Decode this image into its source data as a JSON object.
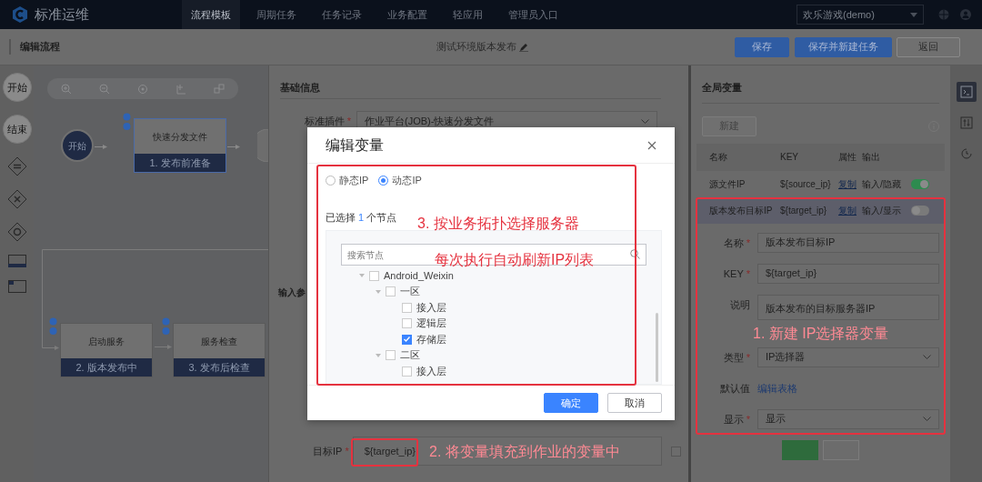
{
  "required_mark": "*",
  "header": {
    "title": "标准运维",
    "nav": [
      {
        "label": "流程模板",
        "selected": true
      },
      {
        "label": "周期任务",
        "selected": false
      },
      {
        "label": "任务记录",
        "selected": false
      },
      {
        "label": "业务配置",
        "selected": false
      },
      {
        "label": "轻应用",
        "selected": false
      },
      {
        "label": "管理员入口",
        "selected": false
      }
    ],
    "business": "欢乐游戏(demo)"
  },
  "toolbar": {
    "title": "编辑流程",
    "flow_name": "测试环境版本发布",
    "buttons": [
      {
        "label": "保存",
        "kind": "primary"
      },
      {
        "label": "保存并新建任务",
        "kind": "primary"
      },
      {
        "label": "返回",
        "kind": "default"
      }
    ]
  },
  "palette": [
    {
      "kind": "circle",
      "label": "开始"
    },
    {
      "kind": "circle",
      "label": "结束"
    },
    {
      "kind": "diamond-equal"
    },
    {
      "kind": "diamond-cross"
    },
    {
      "kind": "diamond-circle"
    },
    {
      "kind": "rect-bar"
    },
    {
      "kind": "rect-corner"
    }
  ],
  "canvas": {
    "nodes": [
      {
        "kind": "start",
        "label": "开始"
      },
      {
        "kind": "task",
        "name": "快速分发文件",
        "stage": "1. 发布前准备",
        "selected": true
      },
      {
        "kind": "task",
        "name": "启动服务",
        "stage": "2. 版本发布中",
        "selected": false
      },
      {
        "kind": "task",
        "name": "服务检查",
        "stage": "3. 发布后检查",
        "selected": false
      }
    ]
  },
  "form": {
    "section": "基础信息",
    "plugin_label": "标准插件",
    "plugin_required": true,
    "plugin_value": "作业平台(JOB)-快速分发文件",
    "input_section": "输入参",
    "target_label": "目标IP",
    "target_required": true,
    "target_value": "${target_ip}",
    "target_checked": false
  },
  "modal": {
    "title": "编辑变量",
    "ip_modes": [
      {
        "label": "静态IP",
        "selected": false
      },
      {
        "label": "动态IP",
        "selected": true
      }
    ],
    "selected_text": {
      "before": "已选择",
      "count": "1",
      "after": "个节点"
    },
    "search_placeholder": "搜索节点",
    "tree": [
      {
        "label": "Android_Weixin",
        "checked": false,
        "expanded": true,
        "children": [
          {
            "label": "一区",
            "checked": false,
            "expanded": true,
            "children": [
              {
                "label": "接入层",
                "checked": false
              },
              {
                "label": "逻辑层",
                "checked": false
              },
              {
                "label": "存储层",
                "checked": true
              }
            ]
          },
          {
            "label": "二区",
            "checked": false,
            "expanded": true,
            "children": [
              {
                "label": "接入层",
                "checked": false
              }
            ]
          }
        ]
      }
    ],
    "buttons": [
      {
        "label": "确定",
        "kind": "primary"
      },
      {
        "label": "取消",
        "kind": "default"
      }
    ]
  },
  "variables": {
    "title": "全局变量",
    "new_button": "新建",
    "columns": [
      "名称",
      "KEY",
      "属性",
      "输出"
    ],
    "rows": [
      {
        "name": "源文件IP",
        "key": "${source_ip}",
        "action": "复制",
        "attr": "输入/隐藏",
        "output": true,
        "selected": false
      },
      {
        "name": "版本发布目标IP",
        "key": "${target_ip}",
        "action": "复制",
        "attr": "输入/显示",
        "output": false,
        "selected": true
      }
    ],
    "fields": [
      {
        "label": "名称",
        "required": true,
        "kind": "input",
        "value": "版本发布目标IP"
      },
      {
        "label": "KEY",
        "required": true,
        "kind": "input",
        "value": "${target_ip}"
      },
      {
        "label": "说明",
        "required": false,
        "kind": "textarea",
        "value": "版本发布的目标服务器IP"
      },
      {
        "label": "类型",
        "required": true,
        "kind": "select",
        "value": "IP选择器"
      },
      {
        "label": "默认值",
        "required": false,
        "kind": "link",
        "value": "编辑表格"
      },
      {
        "label": "显示",
        "required": true,
        "kind": "select",
        "value": "显示"
      }
    ]
  },
  "side_icons": [
    {
      "kind": "terminal",
      "selected": true
    },
    {
      "kind": "sliders",
      "selected": false
    },
    {
      "kind": "history",
      "selected": false
    }
  ],
  "annotations": [
    {
      "text": "3. 按业务拓扑选择服务器"
    },
    {
      "text": "每次执行自动刷新IP列表"
    },
    {
      "text": "1. 新建 IP选择器变量"
    },
    {
      "text": "2. 将变量填充到作业的变量中"
    }
  ]
}
